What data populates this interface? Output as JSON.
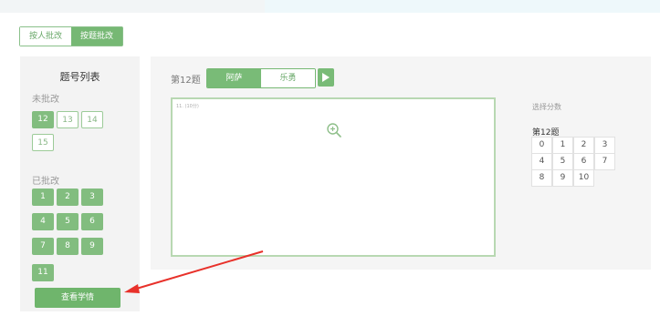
{
  "mode_tabs": [
    {
      "label": "按人批改",
      "active": false
    },
    {
      "label": "按题批改",
      "active": true
    }
  ],
  "sidebar": {
    "title": "题号列表",
    "ungraded_label": "未批改",
    "ungraded": [
      "12",
      "13",
      "14",
      "15"
    ],
    "graded_label": "已批改",
    "graded": [
      "1",
      "2",
      "3",
      "4",
      "5",
      "6",
      "7",
      "8",
      "9",
      "11"
    ],
    "view_button": "查看学情"
  },
  "main": {
    "question_label": "第12题",
    "graders": [
      {
        "label": "阿萨",
        "active": true
      },
      {
        "label": "乐勇",
        "active": false
      }
    ],
    "answer_snippet": "11. (10分)"
  },
  "score_panel": {
    "title": "选择分数",
    "question": "第12题",
    "scores": [
      "0",
      "1",
      "2",
      "3",
      "4",
      "5",
      "6",
      "7",
      "8",
      "9",
      "10"
    ]
  },
  "colors": {
    "accent_green": "#76b874",
    "annotation_red": "#e8312a"
  },
  "icons": {
    "next": "play-triangle-icon",
    "zoom": "zoom-in-icon"
  }
}
